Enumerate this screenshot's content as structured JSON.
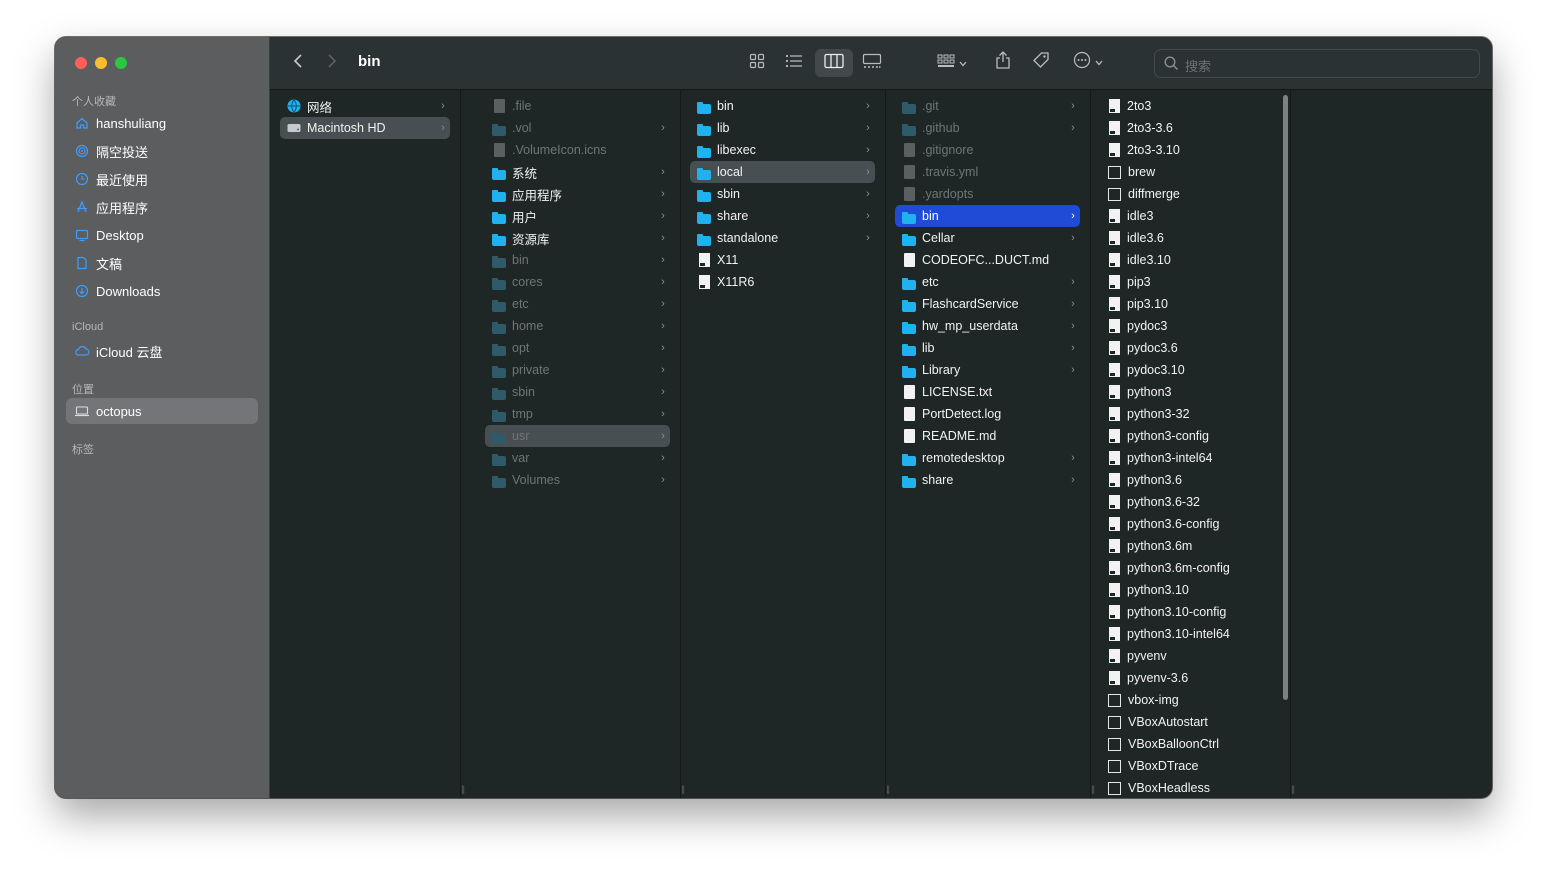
{
  "toolbar": {
    "title": "bin",
    "search_placeholder": "搜索",
    "back_icon": "chevron-left",
    "forward_icon": "chevron-right"
  },
  "sidebar": {
    "sections": {
      "favorites": "个人收藏",
      "icloud": "iCloud",
      "locations": "位置",
      "tags": "标签"
    },
    "favorites": [
      {
        "label": "hanshuliang",
        "icon": "home-icon"
      },
      {
        "label": "隔空投送",
        "icon": "airdrop-icon"
      },
      {
        "label": "最近使用",
        "icon": "clock-icon"
      },
      {
        "label": "应用程序",
        "icon": "apps-icon"
      },
      {
        "label": "Desktop",
        "icon": "desktop-icon"
      },
      {
        "label": "文稿",
        "icon": "document-icon"
      },
      {
        "label": "Downloads",
        "icon": "download-icon"
      }
    ],
    "icloud": [
      {
        "label": "iCloud 云盘",
        "icon": "cloud-icon"
      }
    ],
    "locations": [
      {
        "label": "octopus",
        "icon": "laptop-icon"
      }
    ]
  },
  "columns": [
    {
      "items": [
        {
          "label": "网络",
          "type": "network",
          "chevron": true
        },
        {
          "label": "Macintosh HD",
          "type": "disk",
          "chevron": true,
          "selected": "gray"
        }
      ]
    },
    {
      "items": [
        {
          "label": ".file",
          "type": "doc",
          "dim": true
        },
        {
          "label": ".vol",
          "type": "folder",
          "dim": true,
          "chevron": true
        },
        {
          "label": ".VolumeIcon.icns",
          "type": "doc",
          "dim": true
        },
        {
          "label": "系统",
          "type": "folder",
          "chevron": true
        },
        {
          "label": "应用程序",
          "type": "folder",
          "chevron": true
        },
        {
          "label": "用户",
          "type": "folder",
          "chevron": true
        },
        {
          "label": "资源库",
          "type": "folder",
          "chevron": true
        },
        {
          "label": "bin",
          "type": "folder",
          "dim": true,
          "chevron": true
        },
        {
          "label": "cores",
          "type": "folder",
          "dim": true,
          "chevron": true
        },
        {
          "label": "etc",
          "type": "folder",
          "dim": true,
          "chevron": true
        },
        {
          "label": "home",
          "type": "folder",
          "dim": true,
          "chevron": true
        },
        {
          "label": "opt",
          "type": "folder",
          "dim": true,
          "chevron": true
        },
        {
          "label": "private",
          "type": "folder",
          "dim": true,
          "chevron": true
        },
        {
          "label": "sbin",
          "type": "folder",
          "dim": true,
          "chevron": true
        },
        {
          "label": "tmp",
          "type": "folder",
          "dim": true,
          "chevron": true
        },
        {
          "label": "usr",
          "type": "folder",
          "dim": true,
          "chevron": true,
          "selected": "gray"
        },
        {
          "label": "var",
          "type": "folder",
          "dim": true,
          "chevron": true
        },
        {
          "label": "Volumes",
          "type": "folder",
          "dim": true,
          "chevron": true
        }
      ]
    },
    {
      "items": [
        {
          "label": "bin",
          "type": "folder",
          "chevron": true
        },
        {
          "label": "lib",
          "type": "folder",
          "chevron": true
        },
        {
          "label": "libexec",
          "type": "folder",
          "chevron": true
        },
        {
          "label": "local",
          "type": "folder",
          "chevron": true,
          "selected": "gray"
        },
        {
          "label": "sbin",
          "type": "folder",
          "chevron": true
        },
        {
          "label": "share",
          "type": "folder",
          "chevron": true
        },
        {
          "label": "standalone",
          "type": "folder",
          "chevron": true
        },
        {
          "label": "X11",
          "type": "exec"
        },
        {
          "label": "X11R6",
          "type": "exec"
        }
      ]
    },
    {
      "items": [
        {
          "label": ".git",
          "type": "folder",
          "dim": true,
          "chevron": true
        },
        {
          "label": ".github",
          "type": "folder",
          "dim": true,
          "chevron": true
        },
        {
          "label": ".gitignore",
          "type": "doc",
          "dim": true
        },
        {
          "label": ".travis.yml",
          "type": "doc",
          "dim": true
        },
        {
          "label": ".yardopts",
          "type": "doc",
          "dim": true
        },
        {
          "label": "bin",
          "type": "folder",
          "chevron": true,
          "selected": "blue"
        },
        {
          "label": "Cellar",
          "type": "folder",
          "chevron": true
        },
        {
          "label": "CODEOFC...DUCT.md",
          "type": "doc"
        },
        {
          "label": "etc",
          "type": "folder",
          "chevron": true
        },
        {
          "label": "FlashcardService",
          "type": "folder",
          "chevron": true
        },
        {
          "label": "hw_mp_userdata",
          "type": "folder",
          "chevron": true
        },
        {
          "label": "lib",
          "type": "folder",
          "chevron": true
        },
        {
          "label": "Library",
          "type": "folder",
          "chevron": true
        },
        {
          "label": "LICENSE.txt",
          "type": "doc"
        },
        {
          "label": "PortDetect.log",
          "type": "doc"
        },
        {
          "label": "README.md",
          "type": "doc"
        },
        {
          "label": "remotedesktop",
          "type": "folder",
          "chevron": true
        },
        {
          "label": "share",
          "type": "folder",
          "chevron": true
        }
      ]
    },
    {
      "items": [
        {
          "label": "2to3",
          "type": "exec"
        },
        {
          "label": "2to3-3.6",
          "type": "exec"
        },
        {
          "label": "2to3-3.10",
          "type": "exec"
        },
        {
          "label": "brew",
          "type": "unix"
        },
        {
          "label": "diffmerge",
          "type": "unix"
        },
        {
          "label": "idle3",
          "type": "exec"
        },
        {
          "label": "idle3.6",
          "type": "exec"
        },
        {
          "label": "idle3.10",
          "type": "exec"
        },
        {
          "label": "pip3",
          "type": "exec"
        },
        {
          "label": "pip3.10",
          "type": "exec"
        },
        {
          "label": "pydoc3",
          "type": "exec"
        },
        {
          "label": "pydoc3.6",
          "type": "exec"
        },
        {
          "label": "pydoc3.10",
          "type": "exec"
        },
        {
          "label": "python3",
          "type": "exec"
        },
        {
          "label": "python3-32",
          "type": "exec"
        },
        {
          "label": "python3-config",
          "type": "exec"
        },
        {
          "label": "python3-intel64",
          "type": "exec"
        },
        {
          "label": "python3.6",
          "type": "exec"
        },
        {
          "label": "python3.6-32",
          "type": "exec"
        },
        {
          "label": "python3.6-config",
          "type": "exec"
        },
        {
          "label": "python3.6m",
          "type": "exec"
        },
        {
          "label": "python3.6m-config",
          "type": "exec"
        },
        {
          "label": "python3.10",
          "type": "exec"
        },
        {
          "label": "python3.10-config",
          "type": "exec"
        },
        {
          "label": "python3.10-intel64",
          "type": "exec"
        },
        {
          "label": "pyvenv",
          "type": "exec"
        },
        {
          "label": "pyvenv-3.6",
          "type": "exec"
        },
        {
          "label": "vbox-img",
          "type": "unix"
        },
        {
          "label": "VBoxAutostart",
          "type": "unix"
        },
        {
          "label": "VBoxBalloonCtrl",
          "type": "unix"
        },
        {
          "label": "VBoxDTrace",
          "type": "unix"
        },
        {
          "label": "VBoxHeadless",
          "type": "unix"
        }
      ]
    }
  ],
  "colors": {
    "selection_blue": "#1f4bd7",
    "folder_blue": "#1fb2ee",
    "close": "#fe5f57",
    "minimize": "#febc2e",
    "zoom": "#28c840"
  }
}
